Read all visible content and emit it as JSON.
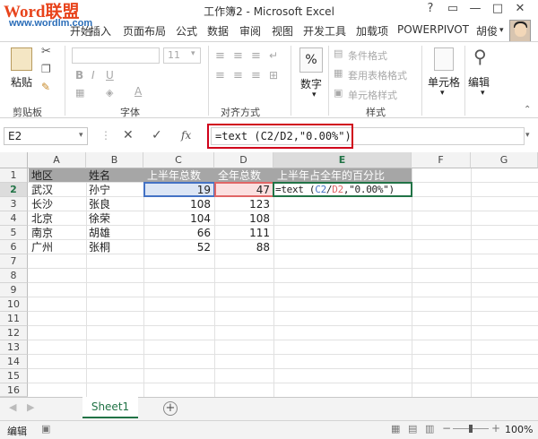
{
  "watermark": {
    "logo": "Word联盟",
    "url": "www.wordlm.com"
  },
  "window": {
    "title": "工作簿2 - Microsoft Excel",
    "controls": [
      "?",
      "▭",
      "—",
      "□",
      "✕"
    ]
  },
  "tabs": [
    "开始",
    "插入",
    "页面布局",
    "公式",
    "数据",
    "审阅",
    "视图",
    "开发工具",
    "加载项",
    "POWERPIVOT"
  ],
  "user": "胡俊",
  "ribbon": {
    "clipboard": {
      "paste": "粘贴",
      "label": "剪贴板"
    },
    "font": {
      "size": "11",
      "label": "字体",
      "bold": "B",
      "italic": "I",
      "underline": "U",
      "fontcolor": "A"
    },
    "alignment": {
      "label": "对齐方式"
    },
    "number": {
      "symbol": "%",
      "label": "数字"
    },
    "styles": {
      "conditional": "条件格式",
      "table": "套用表格格式",
      "cell": "单元格样式",
      "label": "样式"
    },
    "cells": {
      "label": "单元格"
    },
    "editing": {
      "label": "编辑"
    }
  },
  "formula_bar": {
    "name_box": "E2",
    "fx": "fx",
    "formula": "=text (C2/D2,\"0.00%\")"
  },
  "columns": [
    "A",
    "B",
    "C",
    "D",
    "E",
    "F",
    "G"
  ],
  "rows": [
    "1",
    "2",
    "3",
    "4",
    "5",
    "6",
    "7",
    "8",
    "9",
    "10",
    "11",
    "12",
    "13",
    "14",
    "15",
    "16"
  ],
  "table": {
    "headers": [
      "地区",
      "姓名",
      "上半年总数",
      "全年总数",
      "上半年占全年的百分比"
    ],
    "data": [
      [
        "武汉",
        "孙宁",
        "19",
        "47"
      ],
      [
        "长沙",
        "张良",
        "108",
        "123"
      ],
      [
        "北京",
        "徐荣",
        "104",
        "108"
      ],
      [
        "南京",
        "胡雄",
        "66",
        "111"
      ],
      [
        "广州",
        "张桐",
        "52",
        "88"
      ]
    ],
    "edit_cell": {
      "prefix": "=text (",
      "c2": "C2",
      "slash": "/",
      "d2": "D2",
      "suffix": ",\"0.00%\")"
    }
  },
  "sheet": {
    "name": "Sheet1",
    "add": "+"
  },
  "status": {
    "mode": "编辑",
    "zoom": "100%"
  }
}
